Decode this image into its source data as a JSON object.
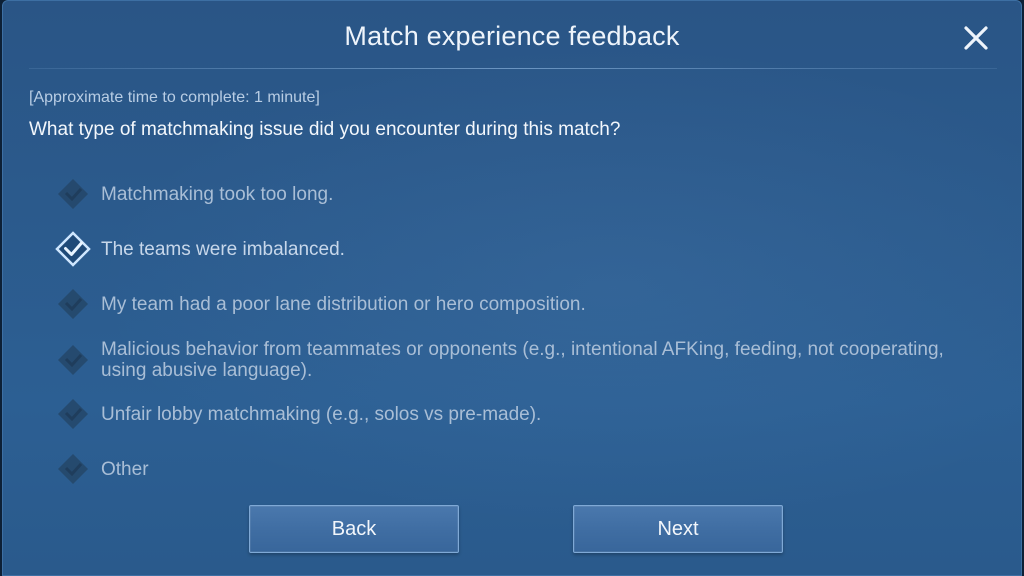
{
  "dialog": {
    "title": "Match experience feedback",
    "close_icon": "close-icon",
    "time_note": "[Approximate time to complete: 1 minute]",
    "question": "What type of matchmaking issue did you encounter during this match?"
  },
  "options": [
    {
      "label": "Matchmaking took too long.",
      "selected": false
    },
    {
      "label": "The teams were imbalanced.",
      "selected": true
    },
    {
      "label": "My team had a poor lane distribution or hero composition.",
      "selected": false
    },
    {
      "label": "Malicious behavior from teammates or opponents (e.g., intentional AFKing, feeding, not cooperating, using abusive language).",
      "selected": false
    },
    {
      "label": "Unfair lobby matchmaking (e.g., solos vs pre-made).",
      "selected": false
    },
    {
      "label": "Other",
      "selected": false
    }
  ],
  "buttons": {
    "back_label": "Back",
    "next_label": "Next"
  },
  "colors": {
    "background": "#2b5a8c",
    "selected_check": "#9fd0ff",
    "unselected_check": "#2a4a6e"
  }
}
